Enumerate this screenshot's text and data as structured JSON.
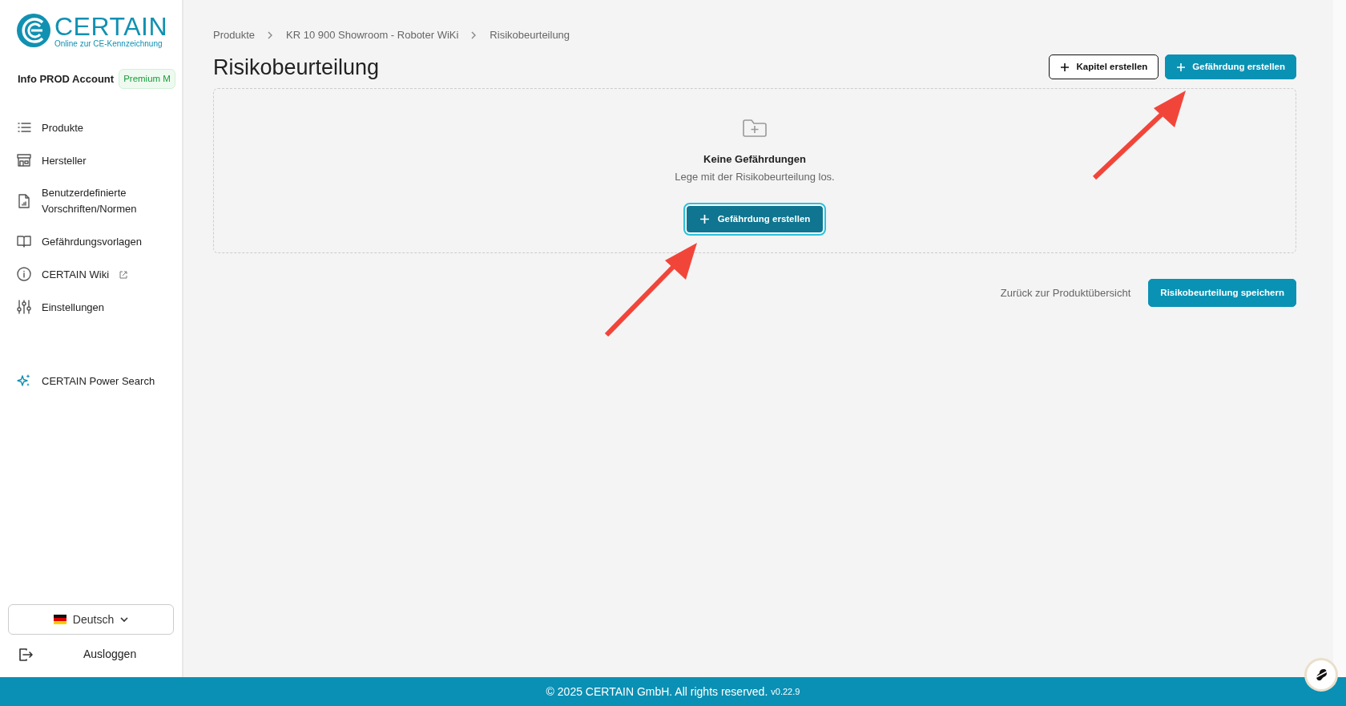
{
  "logo": {
    "name": "CERTAIN",
    "tagline": "Online zur CE-Kennzeichnung"
  },
  "account": {
    "name": "Info PROD Account",
    "plan": "Premium M"
  },
  "sidebar": {
    "items": [
      {
        "label": "Produkte",
        "external": false
      },
      {
        "label": "Hersteller",
        "external": false
      },
      {
        "label": "Benutzerdefinierte Vorschriften/Normen",
        "external": false
      },
      {
        "label": "Gefährdungsvorlagen",
        "external": false
      },
      {
        "label": "CERTAIN Wiki",
        "external": true
      },
      {
        "label": "Einstellungen",
        "external": false
      }
    ],
    "special": {
      "label": "CERTAIN Power Search"
    },
    "language": {
      "label": "Deutsch"
    },
    "logout": {
      "label": "Ausloggen"
    }
  },
  "breadcrumb": [
    "Produkte",
    "KR 10 900 Showroom - Roboter WiKi",
    "Risikobeurteilung"
  ],
  "title": "Risikobeurteilung",
  "header_buttons": [
    {
      "label": "Kapitel erstellen",
      "kind": "outline"
    },
    {
      "label": "Gefährdung erstellen",
      "kind": "primary"
    }
  ],
  "empty_state": {
    "title": "Keine Gefährdungen",
    "text": "Lege mit der Risikobeurteilung los.",
    "button": "Gefährdung erstellen"
  },
  "actions": {
    "back": "Zurück zur Produktübersicht",
    "save": "Risikobeurteilung speichern"
  },
  "footer": {
    "text": "© 2025 CERTAIN GmbH. All rights reserved.",
    "version": "v0.22.9"
  }
}
